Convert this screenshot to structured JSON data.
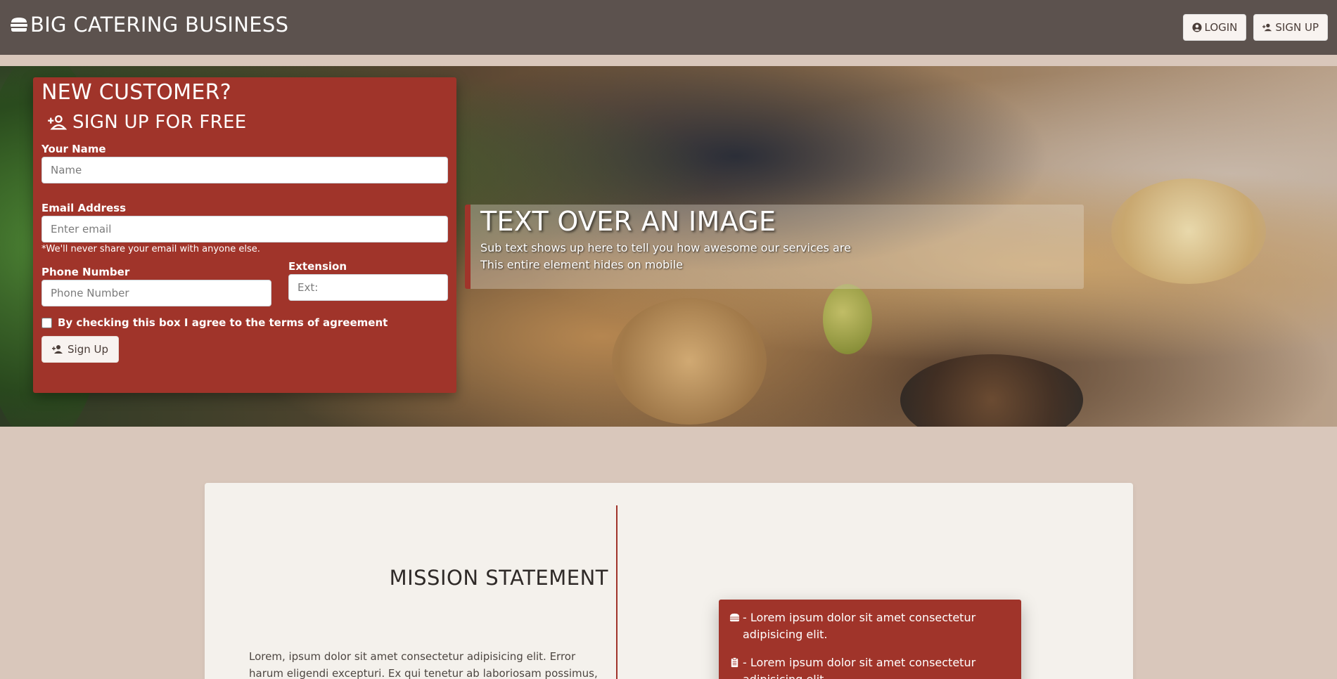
{
  "navbar": {
    "brand": "BIG CATERING BUSINESS",
    "brand_icon": "burger-icon",
    "login_label": "LOGIN",
    "signup_label": "SIGN UP"
  },
  "signup_form": {
    "title": "NEW CUSTOMER?",
    "subtitle": "SIGN UP FOR FREE",
    "name_label": "Your Name",
    "name_placeholder": "Name",
    "email_label": "Email Address",
    "email_placeholder": "Enter email",
    "email_help": "*We'll never share your email with anyone else.",
    "phone_label": "Phone Number",
    "phone_placeholder": "Phone Number",
    "ext_label": "Extension",
    "ext_placeholder": "Ext:",
    "terms_label": "By checking this box I agree to the terms of agreement",
    "submit_label": "Sign Up"
  },
  "hero_overlay": {
    "title": "TEXT OVER AN IMAGE",
    "line1": "Sub text shows up here to tell you how awesome our services are",
    "line2": "This entire element hides on mobile"
  },
  "mission": {
    "title": "MISSION STATEMENT",
    "text": "Lorem, ipsum dolor sit amet consectetur adipisicing elit. Error harum eligendi excepturi. Ex qui tenetur ab laboriosam possimus,"
  },
  "features": [
    {
      "icon": "burger-icon",
      "text": " - Lorem ipsum dolor sit amet consectetur adipisicing elit."
    },
    {
      "icon": "clipboard-icon",
      "text": " - Lorem ipsum dolor sit amet consectetur adipisicing elit."
    }
  ],
  "colors": {
    "navbar": "#5c524e",
    "accent": "#a0342a",
    "page_bg": "#d9c7bb",
    "card_bg": "#f4f1ec"
  }
}
